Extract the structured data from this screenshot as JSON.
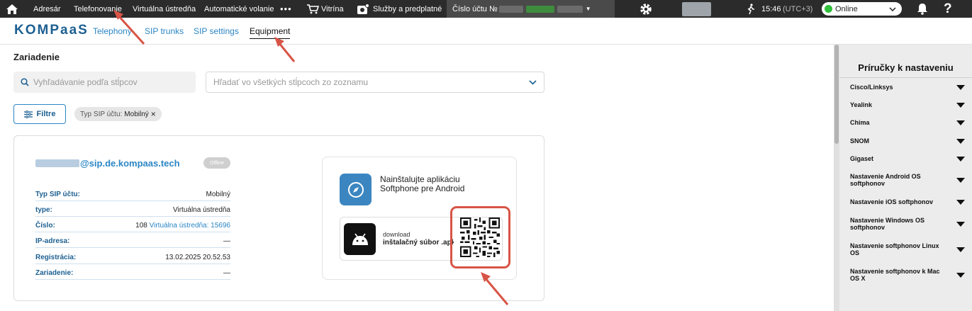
{
  "topbar": {
    "items": [
      "Adresár",
      "Telefonovanie",
      "Virtuálna ústredňa",
      "Automatické volanie"
    ],
    "more": "•••",
    "showcase": "Vitrína",
    "services": "Služby a predplatné",
    "account_label": "Číslo účtu №",
    "time": "15:46",
    "timezone": "(UTC+3)",
    "status": "Online"
  },
  "subnav": {
    "logo": "KOMPaaS",
    "tabs": [
      "Telephony",
      "SIP trunks",
      "SIP settings",
      "Equipment"
    ],
    "active_tab": "Equipment"
  },
  "main": {
    "title": "Zariadenie",
    "search_placeholder": "Vyhľadávanie podľa stĺpcov",
    "search_all_placeholder": "Hľadať vo všetkých stĺpcoch zo zoznamu",
    "filters_label": "Filtre",
    "chip_key": "Typ SIP účtu:",
    "chip_value": "Mobilný",
    "chip_close": "×"
  },
  "device": {
    "sip_domain": "@sip.de.kompaas.tech",
    "status": "Offline",
    "rows": [
      {
        "label": "Typ SIP účtu:",
        "value": "Mobilný",
        "link": ""
      },
      {
        "label": "type:",
        "value": "Virtuálna ústredňa",
        "link": ""
      },
      {
        "label": "Číslo:",
        "value": "108",
        "link": "Virtuálna ústredňa: 15696"
      },
      {
        "label": "IP-adresa:",
        "value": "—",
        "link": ""
      },
      {
        "label": "Registrácia:",
        "value": "13.02.2025 20.52.53",
        "link": ""
      },
      {
        "label": "Zariadenie:",
        "value": "—",
        "link": ""
      }
    ]
  },
  "app": {
    "line1": "Nainštalujte aplikáciu",
    "line2": "Softphone pre Android",
    "download_small": "download",
    "download_main": "inštalačný súbor .apk"
  },
  "sidebar": {
    "title": "Príručky k nastaveniu",
    "items": [
      "Cisco/Linksys",
      "Yealink",
      "Chima",
      "SNOM",
      "Gigaset",
      "Nastavenie Android OS softphonov",
      "Nastavenie iOS softphonov",
      "Nastavenie Windows OS softphonov",
      "Nastavenie softphonov Linux OS",
      "Nastavenie softphonov k Mac OS X"
    ]
  },
  "colors": {
    "accent": "#2b86c5",
    "annotation": "#d85446",
    "online": "#2fbf3a"
  }
}
